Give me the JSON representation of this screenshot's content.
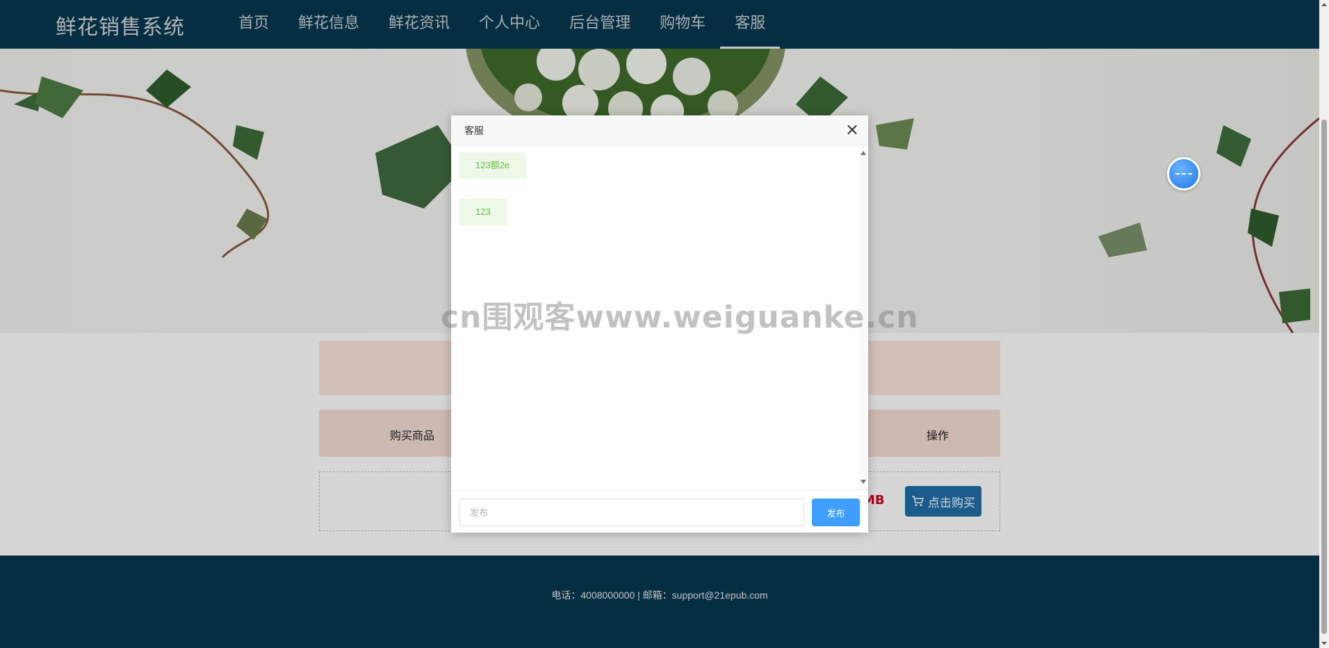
{
  "header": {
    "logo": "鲜花销售系统",
    "nav": [
      {
        "label": "首页"
      },
      {
        "label": "鲜花信息"
      },
      {
        "label": "鲜花资讯"
      },
      {
        "label": "个人中心"
      },
      {
        "label": "后台管理"
      },
      {
        "label": "购物车"
      },
      {
        "label": "客服",
        "active": true
      }
    ]
  },
  "cart": {
    "col_goods": "购买商品",
    "col_operation": "操作",
    "price_fragment": "MB",
    "buy_button": "点击购买"
  },
  "footer": {
    "contact": "电话：4008000000 | 邮箱：support@21epub.com"
  },
  "dialog": {
    "title": "客服",
    "messages": [
      "123额2e",
      "123"
    ],
    "input_placeholder": "发布",
    "send_label": "发布"
  },
  "watermark": "cn围观客www.weiguanke.cn",
  "colors": {
    "header_bg": "#06374f",
    "send_button": "#409eff",
    "buy_button": "#1f6ea6",
    "message_text": "#67c23a",
    "price": "#d0021b"
  },
  "icons": [
    "close-icon",
    "cart-icon",
    "float-assistant-icon"
  ]
}
